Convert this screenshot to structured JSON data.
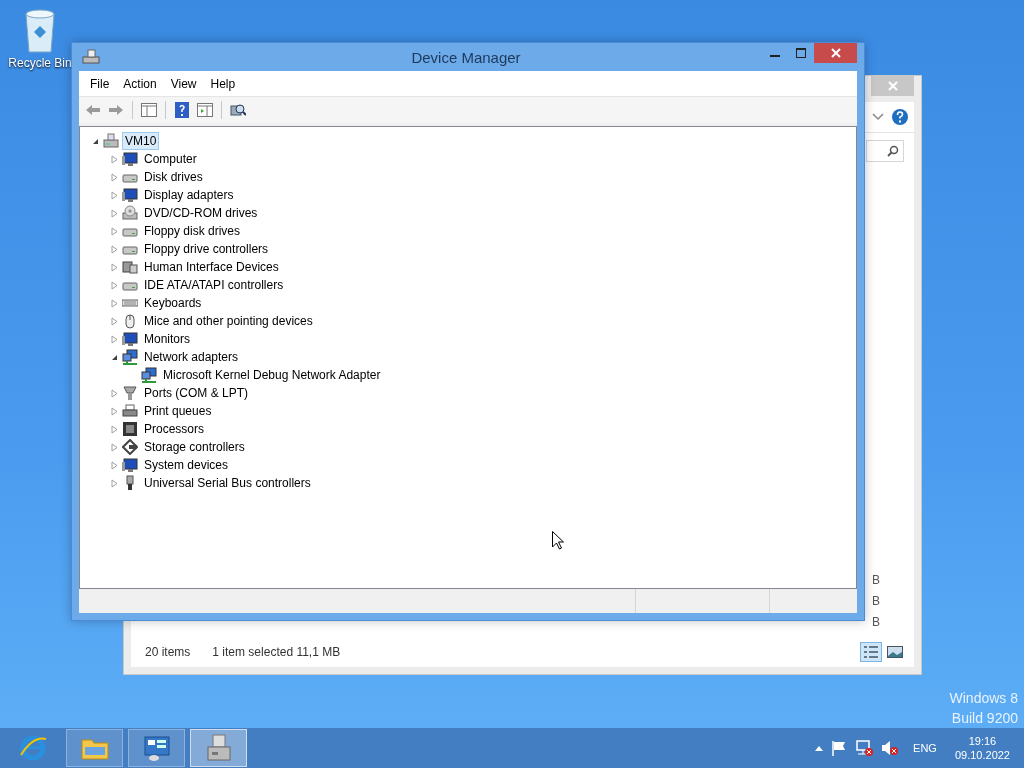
{
  "desktop": {
    "icons": [
      {
        "label": "Recycle Bin",
        "kind": "bin"
      }
    ],
    "build_info": [
      "Windows 8",
      "Build 9200"
    ]
  },
  "background_window": {
    "column_fragments": [
      "B",
      "B",
      "B"
    ],
    "status_count": "20 items",
    "status_selection": "1 item selected  11,1 MB",
    "view_buttons": [
      {
        "kind": "details",
        "selected": true
      },
      {
        "kind": "large_icons",
        "selected": false
      }
    ]
  },
  "window": {
    "title": "Device Manager",
    "menu": [
      "File",
      "Action",
      "View",
      "Help"
    ],
    "toolbar": [
      {
        "kind": "back"
      },
      {
        "kind": "forward"
      },
      {
        "kind": "sep"
      },
      {
        "kind": "panel"
      },
      {
        "kind": "sep"
      },
      {
        "kind": "help"
      },
      {
        "kind": "panel2"
      },
      {
        "kind": "sep"
      },
      {
        "kind": "scan"
      }
    ],
    "tree": {
      "label": "VM10",
      "kind": "computer",
      "expanded": true,
      "selected": true,
      "children": [
        {
          "label": "Computer",
          "kind": "monitor",
          "expanded": false,
          "selected": false
        },
        {
          "label": "Disk drives",
          "kind": "drive",
          "expanded": false,
          "selected": false
        },
        {
          "label": "Display adapters",
          "kind": "monitor",
          "expanded": false,
          "selected": false
        },
        {
          "label": "DVD/CD-ROM drives",
          "kind": "disc",
          "expanded": false,
          "selected": false
        },
        {
          "label": "Floppy disk drives",
          "kind": "drive",
          "expanded": false,
          "selected": false
        },
        {
          "label": "Floppy drive controllers",
          "kind": "drive",
          "expanded": false,
          "selected": false
        },
        {
          "label": "Human Interface Devices",
          "kind": "hid",
          "expanded": false,
          "selected": false
        },
        {
          "label": "IDE ATA/ATAPI controllers",
          "kind": "drive",
          "expanded": false,
          "selected": false
        },
        {
          "label": "Keyboards",
          "kind": "keyboard",
          "expanded": false,
          "selected": false
        },
        {
          "label": "Mice and other pointing devices",
          "kind": "mouse",
          "expanded": false,
          "selected": false
        },
        {
          "label": "Monitors",
          "kind": "monitor",
          "expanded": false,
          "selected": false
        },
        {
          "label": "Network adapters",
          "kind": "network",
          "expanded": true,
          "selected": false,
          "children": [
            {
              "label": "Microsoft Kernel Debug Network Adapter",
              "kind": "network",
              "selected": false
            }
          ]
        },
        {
          "label": "Ports (COM & LPT)",
          "kind": "port",
          "expanded": false,
          "selected": false
        },
        {
          "label": "Print queues",
          "kind": "printer",
          "expanded": false,
          "selected": false
        },
        {
          "label": "Processors",
          "kind": "chip",
          "expanded": false,
          "selected": false
        },
        {
          "label": "Storage controllers",
          "kind": "storage",
          "expanded": false,
          "selected": false
        },
        {
          "label": "System devices",
          "kind": "monitor",
          "expanded": false,
          "selected": false
        },
        {
          "label": "Universal Serial Bus controllers",
          "kind": "usb",
          "expanded": false,
          "selected": false
        }
      ]
    }
  },
  "taskbar": {
    "apps": [
      {
        "kind": "browser",
        "selected": false
      },
      {
        "kind": "folder",
        "selected": false
      },
      {
        "kind": "dashboard",
        "selected": false
      },
      {
        "kind": "device",
        "selected": true
      }
    ],
    "tray": {
      "language": "ENG",
      "time": "19:16",
      "date": "09.10.2022"
    }
  }
}
